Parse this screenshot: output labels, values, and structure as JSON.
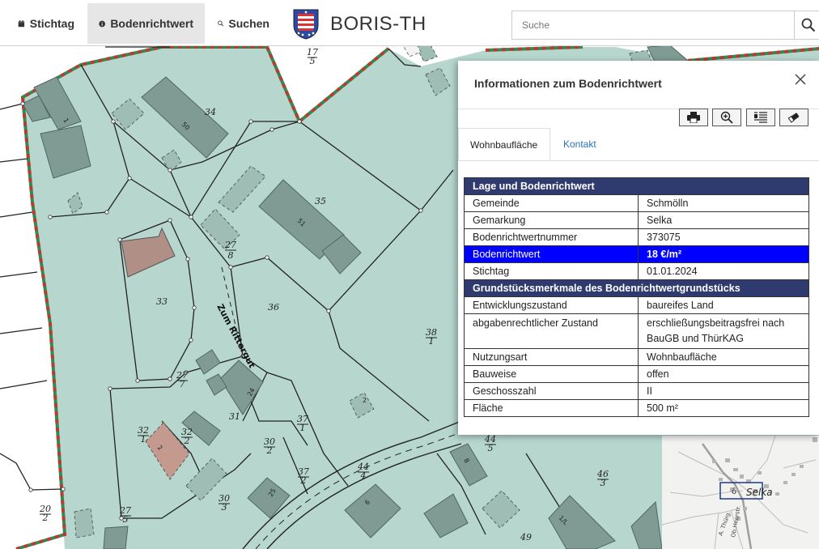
{
  "nav": {
    "tabs": [
      {
        "label": "Stichtag",
        "icon": "calendar-icon"
      },
      {
        "label": "Bodenrichtwert",
        "icon": "info-icon"
      },
      {
        "label": "Suchen",
        "icon": "search-icon"
      }
    ],
    "brand": "BORIS-TH",
    "logo_icon": "thuringia-coat-of-arms-icon"
  },
  "search": {
    "placeholder": "Suche",
    "button_icon": "search-icon"
  },
  "map": {
    "street_label": "Zum Rittergut",
    "parcel_labels": [
      {
        "num": "17",
        "den": "5"
      },
      {
        "text": "34"
      },
      {
        "text": "50"
      },
      {
        "text": "35"
      },
      {
        "text": "51"
      },
      {
        "num": "27",
        "den": "8"
      },
      {
        "text": "36"
      },
      {
        "text": "33"
      },
      {
        "num": "38",
        "den": "1"
      },
      {
        "num": "27",
        "den": "7"
      },
      {
        "num": "32",
        "den": "1"
      },
      {
        "num": "32",
        "den": "2"
      },
      {
        "text": "31"
      },
      {
        "num": "37",
        "den": "1"
      },
      {
        "num": "30",
        "den": "2"
      },
      {
        "num": "37",
        "den": "2"
      },
      {
        "num": "44",
        "den": "4"
      },
      {
        "num": "44",
        "den": "5"
      },
      {
        "num": "46",
        "den": "3"
      },
      {
        "num": "30",
        "den": "3"
      },
      {
        "num": "27",
        "den": "5"
      },
      {
        "num": "20",
        "den": "2"
      },
      {
        "text": "49"
      }
    ],
    "building_numbers": [
      "1",
      "50",
      "51",
      "24",
      "2",
      "25",
      "6",
      "8",
      "2",
      "1/L",
      "3"
    ]
  },
  "minimap": {
    "place": "Selka",
    "streets": [
      "A. Thürg.",
      "Ob.Heerstr."
    ]
  },
  "panel": {
    "title": "Informationen zum Bodenrichtwert",
    "close_icon": "close-icon",
    "tools": [
      {
        "name": "print-button",
        "icon": "print-icon"
      },
      {
        "name": "zoom-button",
        "icon": "zoom-in-icon"
      },
      {
        "name": "legend-button",
        "icon": "list-icon"
      },
      {
        "name": "clear-button",
        "icon": "eraser-icon"
      }
    ],
    "tabs": [
      "Wohnbaufläche",
      "Kontakt"
    ],
    "section1": "Lage und Bodenrichtwert",
    "rows1": [
      {
        "k": "Gemeinde",
        "v": "Schmölln"
      },
      {
        "k": "Gemarkung",
        "v": "Selka"
      },
      {
        "k": "Bodenrichtwertnummer",
        "v": "373075"
      },
      {
        "k": "Bodenrichtwert",
        "v": "18 €/m²",
        "hl": true
      },
      {
        "k": "Stichtag",
        "v": "01.01.2024"
      }
    ],
    "section2": "Grundstücksmerkmale des Bodenrichtwertgrundstücks",
    "rows2": [
      {
        "k": "Entwicklungszustand",
        "v": "baureifes Land"
      },
      {
        "k": "abgabenrechtlicher Zustand",
        "v": "erschließungsbeitragsfrei nach BauGB und ThürKAG",
        "tall": true
      },
      {
        "k": "Nutzungsart",
        "v": "Wohnbaufläche"
      },
      {
        "k": "Bauweise",
        "v": "offen"
      },
      {
        "k": "Geschosszahl",
        "v": "II"
      },
      {
        "k": "Fläche",
        "v": "500 m²"
      }
    ]
  },
  "colors": {
    "zone_fill": "#b6d6ce",
    "building": "#7f9b93",
    "building_red": "#c49a8e",
    "zone_border_red": "#c0392b",
    "zone_border_green": "#2e8b57",
    "table_header": "#2f3b6e",
    "highlight": "#0000ff",
    "link": "#2a74b5"
  }
}
